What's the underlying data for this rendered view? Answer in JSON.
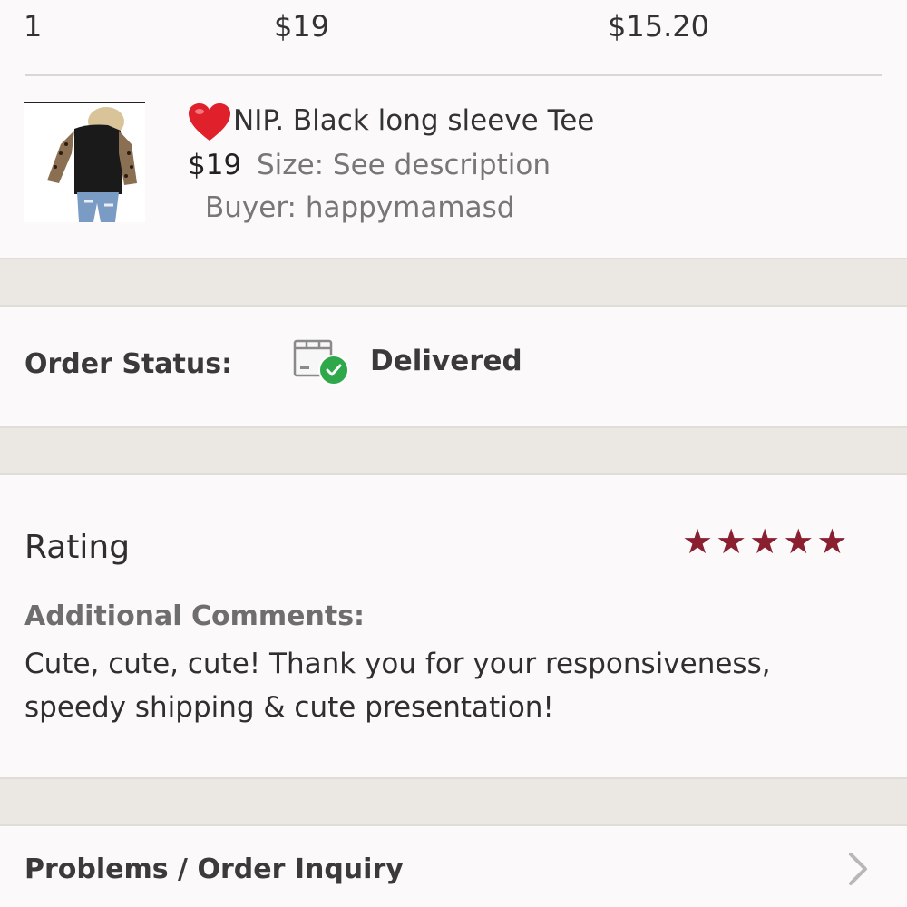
{
  "summary": {
    "quantity": "1",
    "price": "$19",
    "earnings": "$15.20"
  },
  "item": {
    "title": "NIP. Black long sleeve Tee",
    "price": "$19",
    "size": "Size: See description",
    "buyer": "Buyer: happymamasd",
    "icon": "heart-icon",
    "accent": "#e0202a"
  },
  "order": {
    "status_label": "Order Status:",
    "status_value": "Delivered",
    "status_icon": "delivered-box-check-icon",
    "check_color": "#2ea84a"
  },
  "rating": {
    "label": "Rating",
    "stars": 5,
    "star_color": "#8a1f30",
    "comments_label": "Additional Comments:",
    "comments": "Cute, cute, cute! Thank you for your responsiveness, speedy shipping & cute presentation!"
  },
  "inquiry": {
    "label": "Problems / Order Inquiry",
    "icon": "chevron-right-icon"
  }
}
